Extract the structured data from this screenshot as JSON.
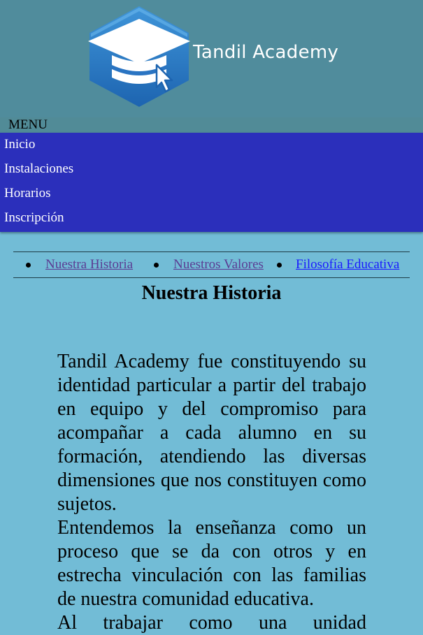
{
  "header": {
    "brand_name": "Tandil Academy",
    "logo_icon": "graduation-cap-cursor-icon"
  },
  "menu": {
    "label": "MENU",
    "items": [
      {
        "label": "Inicio"
      },
      {
        "label": "Instalaciones"
      },
      {
        "label": "Horarios"
      },
      {
        "label": "Inscripción"
      }
    ]
  },
  "subnav": {
    "links": [
      {
        "label": "Nuestra Historia",
        "state": "visited"
      },
      {
        "label": "Nuestros Valores",
        "state": "visited"
      },
      {
        "label": "Filosofía Educativa",
        "state": "unvisited"
      }
    ]
  },
  "main": {
    "title": "Nuestra Historia",
    "paragraphs": [
      "Tandil Academy fue constituyendo su identidad particular a partir del trabajo en equipo y del compromiso para acompañar a cada alumno en su formación, atendiendo las diversas dimensiones que nos constituyen como sujetos.",
      "Entendemos la enseñanza como un proceso que se da con otros y en estrecha vinculación con las familias de nuestra comunidad educativa.",
      "Al trabajar como una unidad"
    ]
  },
  "colors": {
    "page_bg": "#72bcd6",
    "header_bg": "#508c9c",
    "nav_bg": "#2b2fbb",
    "visited_link": "#5b3c93",
    "link": "#1a1aff"
  }
}
